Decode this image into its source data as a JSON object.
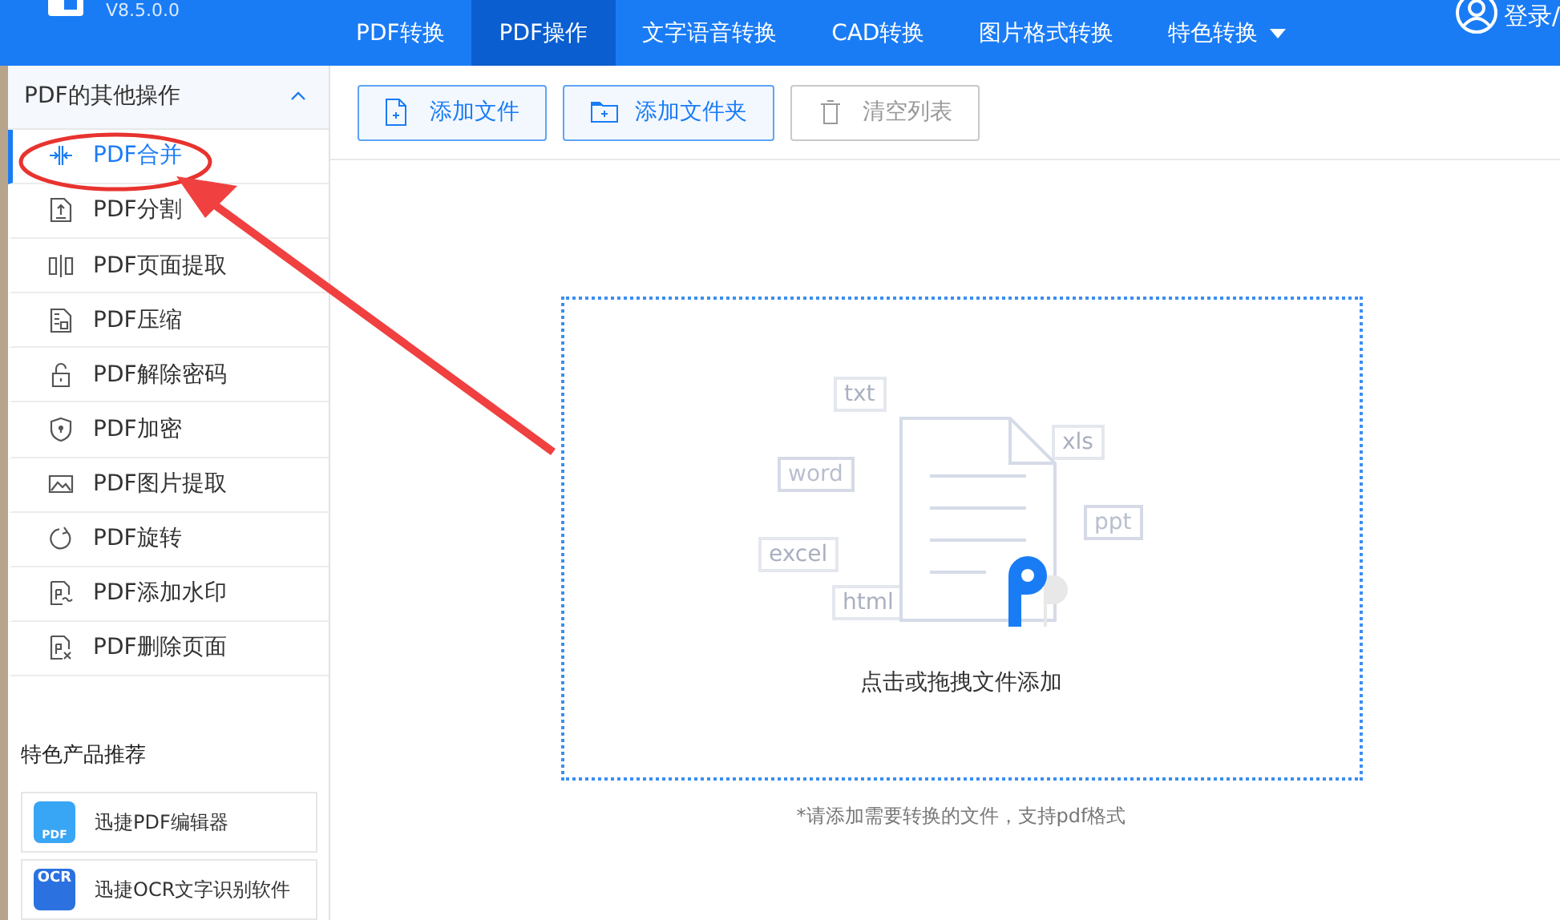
{
  "app": {
    "version": "V8.5.0.0"
  },
  "nav": [
    {
      "label": "PDF转换",
      "selected": false,
      "dropdown": false
    },
    {
      "label": "PDF操作",
      "selected": true,
      "dropdown": false
    },
    {
      "label": "文字语音转换",
      "selected": false,
      "dropdown": false
    },
    {
      "label": "CAD转换",
      "selected": false,
      "dropdown": false
    },
    {
      "label": "图片格式转换",
      "selected": false,
      "dropdown": false
    },
    {
      "label": "特色转换",
      "selected": false,
      "dropdown": true
    }
  ],
  "user": {
    "label": "登录/"
  },
  "sidebar": {
    "title": "PDF的其他操作",
    "expanded": true,
    "items": [
      {
        "label": "PDF合并",
        "kind": "merge",
        "selected": true
      },
      {
        "label": "PDF分割",
        "kind": "split",
        "selected": false
      },
      {
        "label": "PDF页面提取",
        "kind": "extract",
        "selected": false
      },
      {
        "label": "PDF压缩",
        "kind": "compress",
        "selected": false
      },
      {
        "label": "PDF解除密码",
        "kind": "unlock",
        "selected": false
      },
      {
        "label": "PDF加密",
        "kind": "shield",
        "selected": false
      },
      {
        "label": "PDF图片提取",
        "kind": "image",
        "selected": false
      },
      {
        "label": "PDF旋转",
        "kind": "rotate",
        "selected": false
      },
      {
        "label": "PDF添加水印",
        "kind": "watermark",
        "selected": false
      },
      {
        "label": "PDF删除页面",
        "kind": "delete",
        "selected": false
      }
    ]
  },
  "products": {
    "title": "特色产品推荐",
    "items": [
      {
        "label": "迅捷PDF编辑器",
        "kind": "pdf",
        "badge": "PDF"
      },
      {
        "label": "迅捷OCR文字识别软件",
        "kind": "ocr",
        "badge": "OCR"
      }
    ]
  },
  "toolbar": [
    {
      "label": "添加文件",
      "kind": "file",
      "disabled": false
    },
    {
      "label": "添加文件夹",
      "kind": "folder",
      "disabled": false
    },
    {
      "label": "清空列表",
      "kind": "trash",
      "disabled": true
    }
  ],
  "dropzone": {
    "tags": [
      "txt",
      "word",
      "xls",
      "ppt",
      "excel",
      "html"
    ],
    "label": "点击或拖拽文件添加"
  },
  "hint": "*请添加需要转换的文件，支持pdf格式"
}
